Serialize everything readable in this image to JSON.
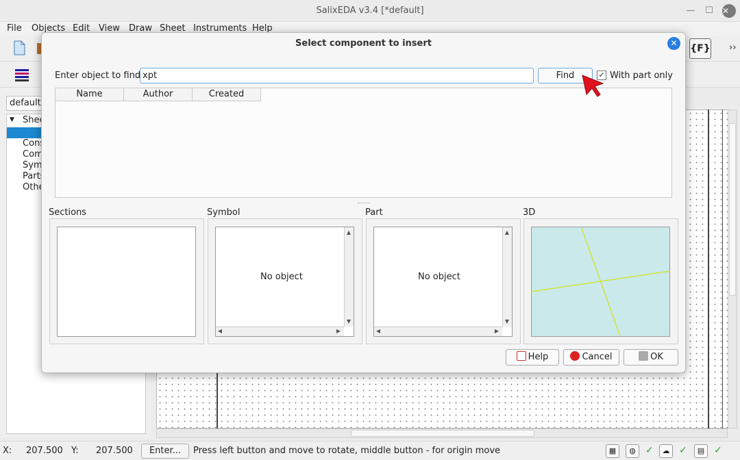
{
  "window": {
    "title": "SalixEDA v3.4 [*default]"
  },
  "menubar": {
    "items": [
      "File",
      "Objects",
      "Edit",
      "View",
      "Draw",
      "Sheet",
      "Instruments",
      "Help"
    ]
  },
  "toolbar": {
    "overflow_glyph": "››",
    "formula_icon_label": "{F}"
  },
  "left_panel": {
    "project_value": "default",
    "tree_items": [
      "Shee",
      "Cons",
      "Com",
      "Sym",
      "Parts",
      "Othe"
    ]
  },
  "dialog": {
    "title": "Select component to insert",
    "find_label": "Enter object to find:",
    "find_value": "xpt",
    "find_button": "Find",
    "part_only_label": "With part only",
    "part_only_checked": true,
    "columns": [
      "Name",
      "Author",
      "Created"
    ],
    "sections": {
      "sections_label": "Sections",
      "symbol_label": "Symbol",
      "part_label": "Part",
      "three_d_label": "3D"
    },
    "no_object_text": "No object",
    "buttons": {
      "help": "Help",
      "cancel": "Cancel",
      "ok": "OK"
    },
    "colors": {
      "preview_bg": "#c9e9ea",
      "preview_line": "#d4e21a",
      "close_btn": "#2a7ee0"
    }
  },
  "status": {
    "x_label": "X:",
    "x_value": "207.500",
    "y_label": "Y:",
    "y_value": "207.500",
    "enter_button": "Enter...",
    "message": "Press left button and move to rotate, middle button - for origin move"
  }
}
